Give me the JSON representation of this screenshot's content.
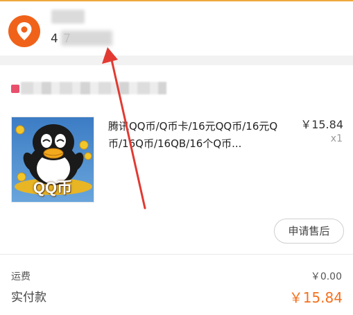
{
  "colors": {
    "accent": "#f0621a",
    "top_line": "#f0a83c",
    "pay_total": "#f5701e",
    "store_mark": "#e8506c",
    "annotation_arrow": "#e23a32"
  },
  "address": {
    "icon": "location-pin-icon",
    "phone_visible": "4          7"
  },
  "product": {
    "image_label": "QQ币",
    "title": "腾讯QQ币/Q币卡/16元QQ币/16元Q币/16Q币/16QB/16个Q币...",
    "price": "￥15.84",
    "quantity": "x1"
  },
  "actions": {
    "after_sale_label": "申请售后"
  },
  "summary": {
    "shipping_label": "运费",
    "shipping_value": "￥0.00",
    "paid_label": "实付款",
    "paid_value": "￥15.84"
  }
}
